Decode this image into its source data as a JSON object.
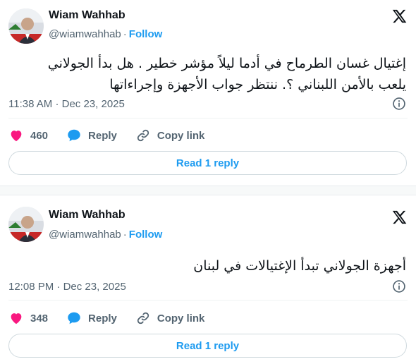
{
  "tweets": [
    {
      "author_name": "Wiam Wahhab",
      "handle": "@wiamwahhab",
      "separator": "·",
      "follow_label": "Follow",
      "text_lines": [
        "إغتيال غسان الطرماح في أدما ليلاً مؤشر خطير . هل بدأ الجولاني",
        "يلعب بالأمن اللبناني ؟. ننتظر جواب الأجهزة وإجراءاتها"
      ],
      "time": "11:38 AM",
      "date": "Dec 23, 2025",
      "likes": "460",
      "reply_label": "Reply",
      "copy_label": "Copy link",
      "read_reply_label": "Read 1 reply"
    },
    {
      "author_name": "Wiam Wahhab",
      "handle": "@wiamwahhab",
      "separator": "·",
      "follow_label": "Follow",
      "text_lines": [
        "أجهزة الجولاني تبدأ الإغتيالات في لبنان"
      ],
      "time": "12:08 PM",
      "date": "Dec 23, 2025",
      "likes": "348",
      "reply_label": "Reply",
      "copy_label": "Copy link",
      "read_reply_label": "Read 1 reply"
    }
  ],
  "colors": {
    "accent": "#1d9bf0",
    "heart": "#f91880",
    "muted": "#536471",
    "border": "#cfd9de"
  },
  "icons": [
    "x-logo-icon",
    "info-icon",
    "heart-icon",
    "reply-bubble-icon",
    "link-icon"
  ]
}
